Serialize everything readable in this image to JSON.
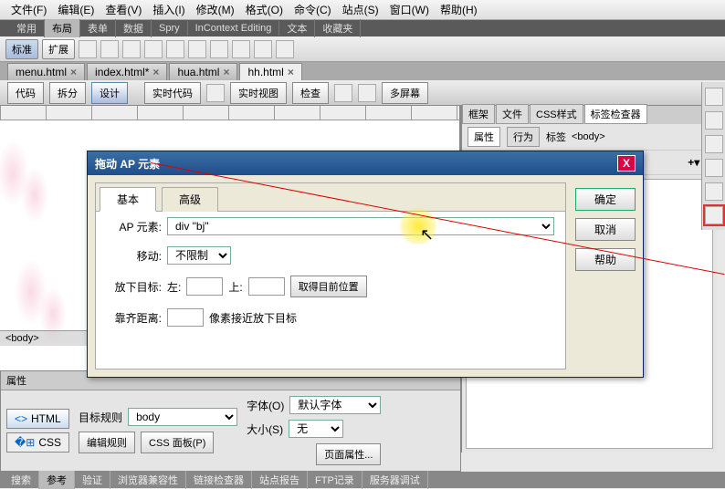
{
  "menubar": [
    "文件(F)",
    "编辑(E)",
    "查看(V)",
    "插入(I)",
    "修改(M)",
    "格式(O)",
    "命令(C)",
    "站点(S)",
    "窗口(W)",
    "帮助(H)"
  ],
  "cat_tabs": {
    "items": [
      "常用",
      "布局",
      "表单",
      "数据",
      "Spry",
      "InContext Editing",
      "文本",
      "收藏夹"
    ],
    "active": 1
  },
  "mode_buttons": {
    "items": [
      "标准",
      "扩展"
    ],
    "active": 0
  },
  "doc_tabs": {
    "items": [
      "menu.html",
      "index.html*",
      "hua.html",
      "hh.html"
    ],
    "active": 3
  },
  "view_buttons": {
    "group1": [
      "代码",
      "拆分",
      "设计"
    ],
    "active1": 2,
    "rt_code": "实时代码",
    "rt_view": "实时视图",
    "inspect": "检查",
    "multiscreen": "多屏幕"
  },
  "status_path": "<body>",
  "right_panel": {
    "tabs1": {
      "items": [
        "框架",
        "文件",
        "CSS样式",
        "标签检查器"
      ],
      "active": 3
    },
    "tabs2": {
      "items": [
        "属性",
        "行为"
      ],
      "active": 0
    },
    "tag_label": "标签",
    "tag_value": "<body>"
  },
  "dialog": {
    "title": "拖动 AP 元素",
    "tabs": {
      "items": [
        "基本",
        "高级"
      ],
      "active": 0
    },
    "ap_label": "AP 元素:",
    "ap_value": "div \"bj\"",
    "move_label": "移动:",
    "move_value": "不限制",
    "drop_label": "放下目标:",
    "left_label": "左:",
    "top_label": "上:",
    "get_pos": "取得目前位置",
    "snap_label": "靠齐距离:",
    "snap_suffix": "像素接近放下目标",
    "ok": "确定",
    "cancel": "取消",
    "help": "帮助"
  },
  "properties": {
    "header": "属性",
    "html_tab": "HTML",
    "css_tab": "CSS",
    "rule_label": "目标规则",
    "rule_value": "body",
    "edit_rule": "编辑规则",
    "css_panel": "CSS 面板(P)",
    "font_label": "字体(O)",
    "font_value": "默认字体",
    "size_label": "大小(S)",
    "size_value": "无",
    "page_props": "页面属性..."
  },
  "footer_tabs": {
    "items": [
      "搜索",
      "参考",
      "验证",
      "浏览器兼容性",
      "链接检查器",
      "站点报告",
      "FTP记录",
      "服务器调试"
    ],
    "active": 1
  }
}
